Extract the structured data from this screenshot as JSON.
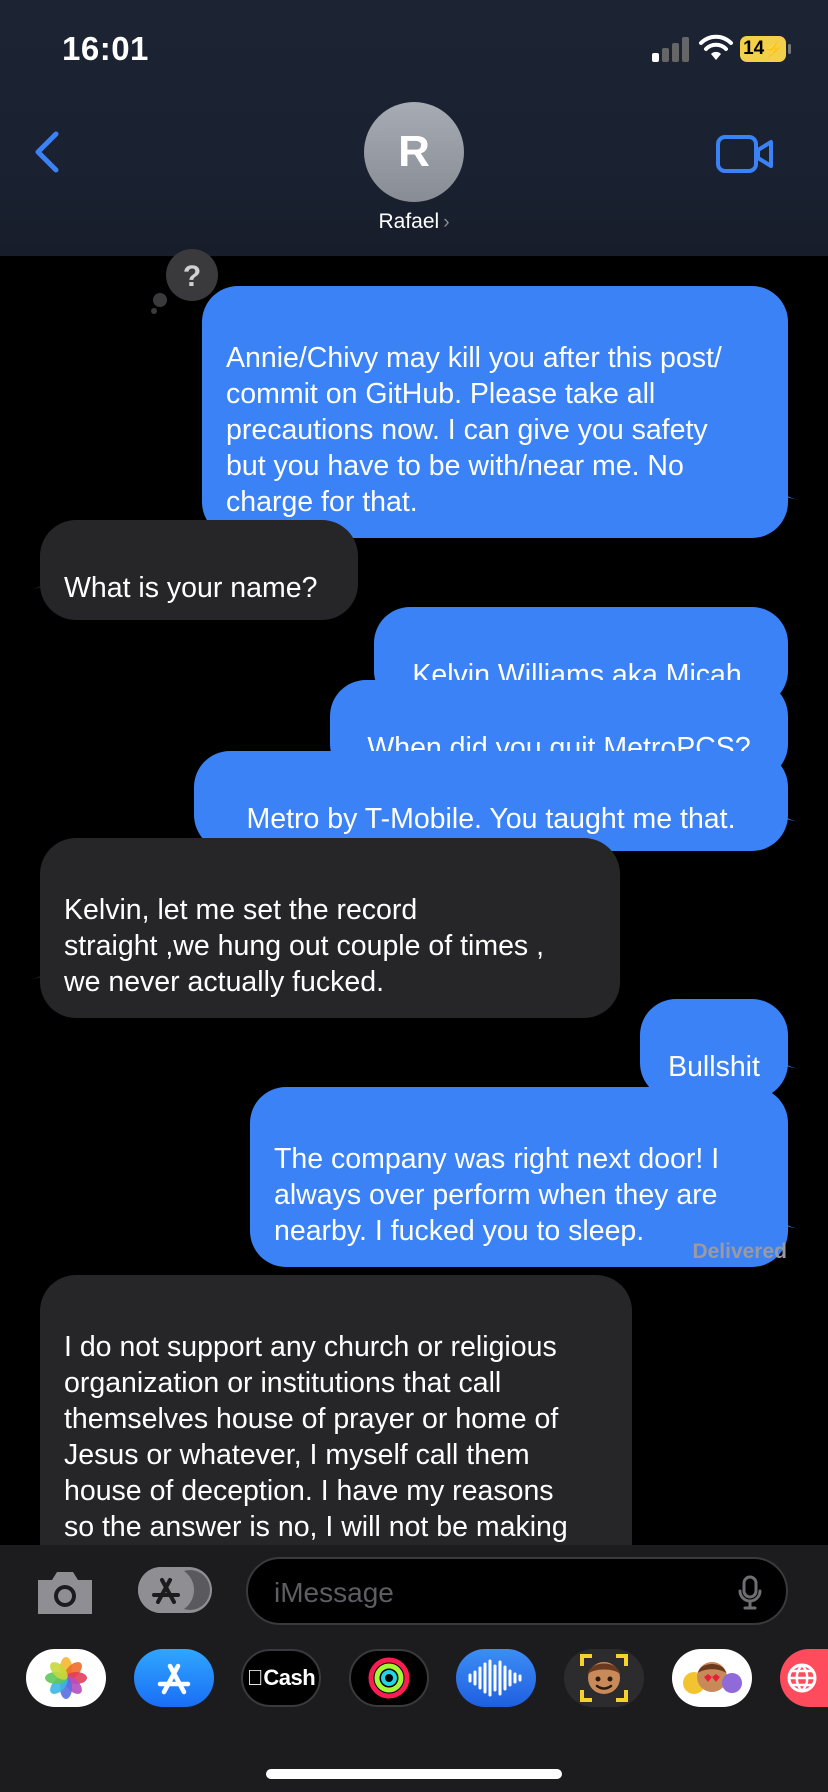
{
  "status_bar": {
    "time": "16:01",
    "battery": "14"
  },
  "header": {
    "avatar_initial": "R",
    "contact_name": "Rafael"
  },
  "messages": [
    {
      "dir": "sent",
      "text": "Annie/Chivy may kill you after this post/\ncommit on GitHub. Please take all\nprecautions now. I can give you safety\nbut you have to be with/near me. No\ncharge for that."
    },
    {
      "dir": "recv",
      "text": "What is your name?"
    },
    {
      "dir": "sent",
      "text": "Kelvin Williams aka Micah."
    },
    {
      "dir": "sent",
      "text": "When did you quit MetroPCS?"
    },
    {
      "dir": "sent",
      "text": "Metro by T-Mobile. You taught me that."
    },
    {
      "dir": "recv",
      "text": "Kelvin, let me set the record\nstraight ,we hung out couple of times ,\nwe never actually fucked."
    },
    {
      "dir": "sent",
      "text": "Bullshit"
    },
    {
      "dir": "sent",
      "text": "The company was right next door! I\nalways over perform when they are\nnearby. I fucked you to sleep."
    },
    {
      "dir": "recv",
      "text": "I do not support any church or religious\norganization or institutions that call\nthemselves house of prayer or home of\nJesus or whatever, I myself call them\nhouse of deception. I have my reasons\nso the answer is no, I will not be making\nany donations or contributions to your"
    }
  ],
  "delivered_label": "Delivered",
  "input": {
    "placeholder": "iMessage"
  },
  "app_tray": {
    "items": [
      "photos-icon",
      "app-store-icon",
      "apple-cash-icon",
      "activity-icon",
      "audio-message-icon",
      "memoji-icon",
      "animoji-icon",
      "web-icon"
    ],
    "cash_label": "Cash"
  }
}
